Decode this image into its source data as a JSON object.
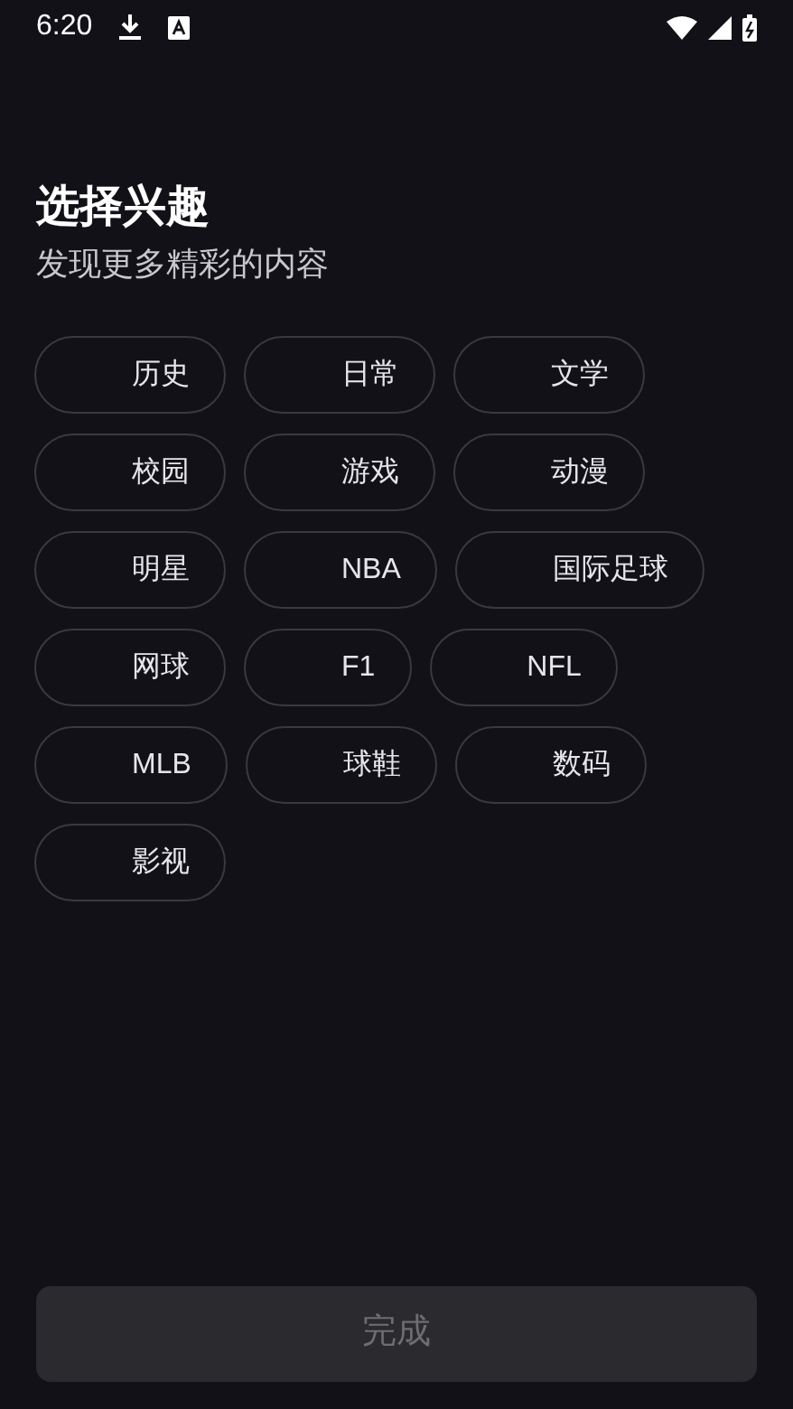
{
  "status_bar": {
    "time": "6:20"
  },
  "header": {
    "title": "选择兴趣",
    "subtitle": "发现更多精彩的内容"
  },
  "interests": [
    {
      "label": "历史",
      "selected": false
    },
    {
      "label": "日常",
      "selected": false
    },
    {
      "label": "文学",
      "selected": false
    },
    {
      "label": "校园",
      "selected": false
    },
    {
      "label": "游戏",
      "selected": false
    },
    {
      "label": "动漫",
      "selected": false
    },
    {
      "label": "明星",
      "selected": false
    },
    {
      "label": "NBA",
      "selected": false
    },
    {
      "label": "国际足球",
      "selected": false
    },
    {
      "label": "网球",
      "selected": false
    },
    {
      "label": "F1",
      "selected": false
    },
    {
      "label": "NFL",
      "selected": false
    },
    {
      "label": "MLB",
      "selected": false
    },
    {
      "label": "球鞋",
      "selected": false
    },
    {
      "label": "数码",
      "selected": false
    },
    {
      "label": "影视",
      "selected": false
    }
  ],
  "done_button": {
    "label": "完成",
    "disabled": true
  }
}
